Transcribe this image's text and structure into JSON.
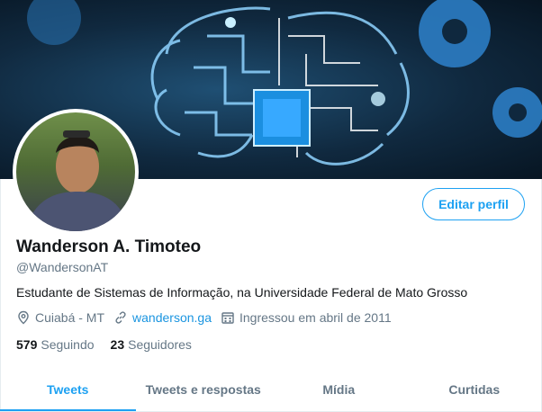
{
  "profile": {
    "name": "Wanderson A. Timoteo",
    "handle": "@WandersonAT",
    "bio": "Estudante de Sistemas de Informação, na Universidade Federal de Mato Grosso",
    "location": "Cuiabá - MT",
    "website": "wanderson.ga",
    "joined": "Ingressou em abril de 2011"
  },
  "actions": {
    "edit_profile": "Editar perfil"
  },
  "stats": {
    "following_count": "579",
    "following_label": "Seguindo",
    "followers_count": "23",
    "followers_label": "Seguidores"
  },
  "tabs": [
    {
      "label": "Tweets",
      "active": true
    },
    {
      "label": "Tweets e respostas",
      "active": false
    },
    {
      "label": "Mídia",
      "active": false
    },
    {
      "label": "Curtidas",
      "active": false
    }
  ],
  "colors": {
    "accent": "#1da1f2",
    "link": "#1b95e0",
    "muted": "#657786",
    "text": "#14171a"
  },
  "icons": [
    "location-icon",
    "link-icon",
    "calendar-icon"
  ]
}
